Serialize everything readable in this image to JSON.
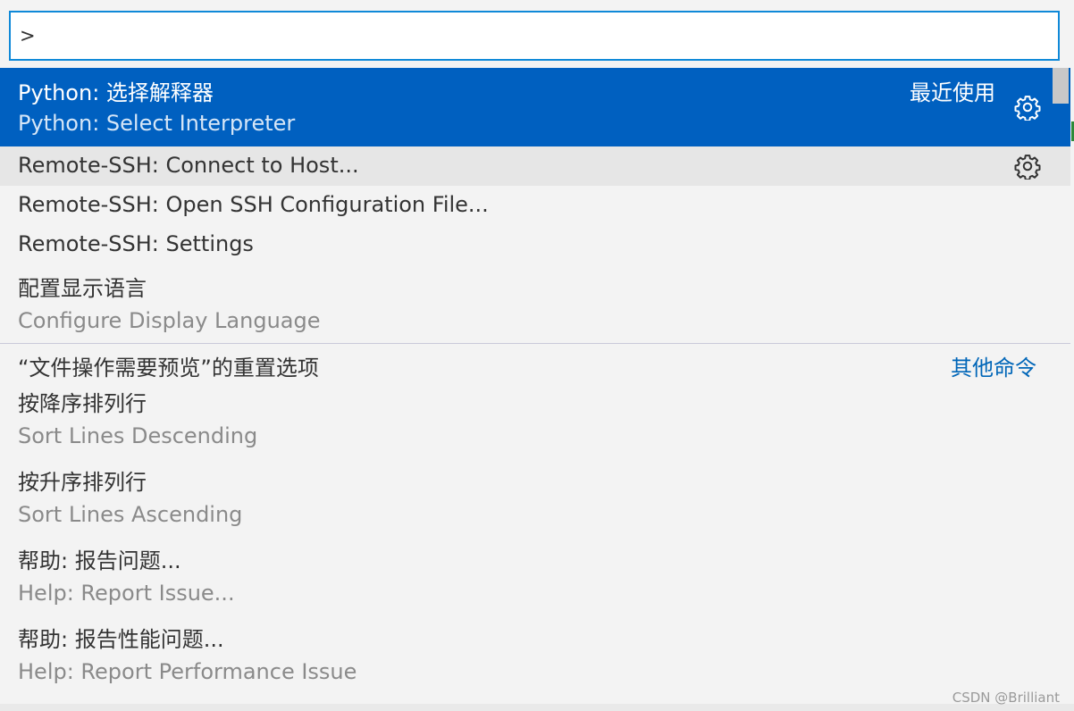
{
  "search": {
    "value": ">",
    "placeholder": ""
  },
  "items": {
    "python_select": {
      "label": "Python: 选择解释器",
      "description": "Python: Select Interpreter",
      "group": "最近使用"
    },
    "ssh_connect": {
      "label": "Remote-SSH: Connect to Host..."
    },
    "ssh_config": {
      "label": "Remote-SSH: Open SSH Configuration File..."
    },
    "ssh_settings": {
      "label": "Remote-SSH: Settings"
    },
    "display_lang": {
      "label": "配置显示语言",
      "description": "Configure Display Language"
    },
    "reset_preview": {
      "label": "“文件操作需要预览”的重置选项",
      "group": "其他命令"
    },
    "sort_desc": {
      "label": "按降序排列行",
      "description": "Sort Lines Descending"
    },
    "sort_asc": {
      "label": "按升序排列行",
      "description": "Sort Lines Ascending"
    },
    "report_issue": {
      "label": "帮助: 报告问题...",
      "description": "Help: Report Issue..."
    },
    "report_perf": {
      "label": "帮助: 报告性能问题...",
      "description": "Help: Report Performance Issue"
    }
  },
  "watermark": "CSDN @Brilliant",
  "icons": {
    "gear": "gear-icon"
  },
  "colors": {
    "selection": "#0060c0",
    "focus_border": "#0f89d8",
    "group_label": "#0066b8"
  }
}
